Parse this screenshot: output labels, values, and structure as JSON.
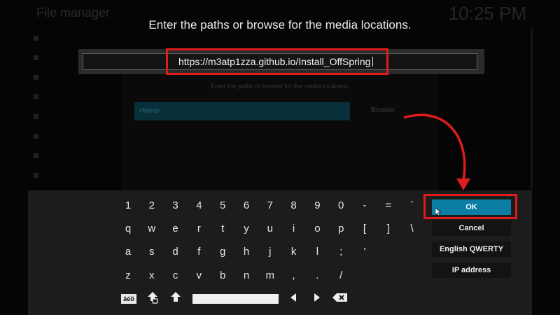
{
  "background": {
    "title": "File manager",
    "clock": "10:25 PM"
  },
  "dialog": {
    "title": "Enter the paths or browse for the media locations.",
    "input_value": "https://m3atp1zza.github.io/Install_OffSpring"
  },
  "keyboard": {
    "row1": [
      "1",
      "2",
      "3",
      "4",
      "5",
      "6",
      "7",
      "8",
      "9",
      "0",
      "-",
      "=",
      "`"
    ],
    "row2": [
      "q",
      "w",
      "e",
      "r",
      "t",
      "y",
      "u",
      "i",
      "o",
      "p",
      "[",
      "]",
      "\\"
    ],
    "row3": [
      "a",
      "s",
      "d",
      "f",
      "g",
      "h",
      "j",
      "k",
      "l",
      ";",
      "'"
    ],
    "row4": [
      "z",
      "x",
      "c",
      "v",
      "b",
      "n",
      "m",
      ",",
      ".",
      "/"
    ],
    "accent_label": "âéö"
  },
  "buttons": {
    "ok": "OK",
    "cancel": "Cancel",
    "layout": "English QWERTY",
    "ip": "IP address"
  },
  "colors": {
    "highlight": "#e01b1b",
    "ok_button": "#0b7ea6"
  }
}
